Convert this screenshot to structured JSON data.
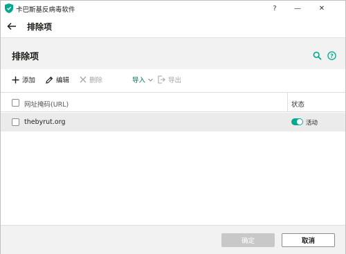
{
  "window": {
    "title": "卡巴斯基反病毒软件",
    "help_glyph": "?",
    "minimize_glyph": "—",
    "close_glyph": "✕"
  },
  "nav": {
    "title": "排除项"
  },
  "header": {
    "title": "排除项"
  },
  "toolbar": {
    "add_label": "添加",
    "edit_label": "编辑",
    "delete_label": "删除",
    "import_label": "导入",
    "export_label": "导出"
  },
  "table": {
    "columns": [
      "网址掩码(URL)",
      "状态"
    ],
    "rows": [
      {
        "url": "thebyrut.org",
        "status": "活动",
        "enabled": true
      }
    ]
  },
  "footer": {
    "ok_label": "确定",
    "cancel_label": "取消"
  },
  "colors": {
    "accent": "#00a88e",
    "import_text": "#006d5c",
    "disabled_text": "#a5a5a5"
  }
}
